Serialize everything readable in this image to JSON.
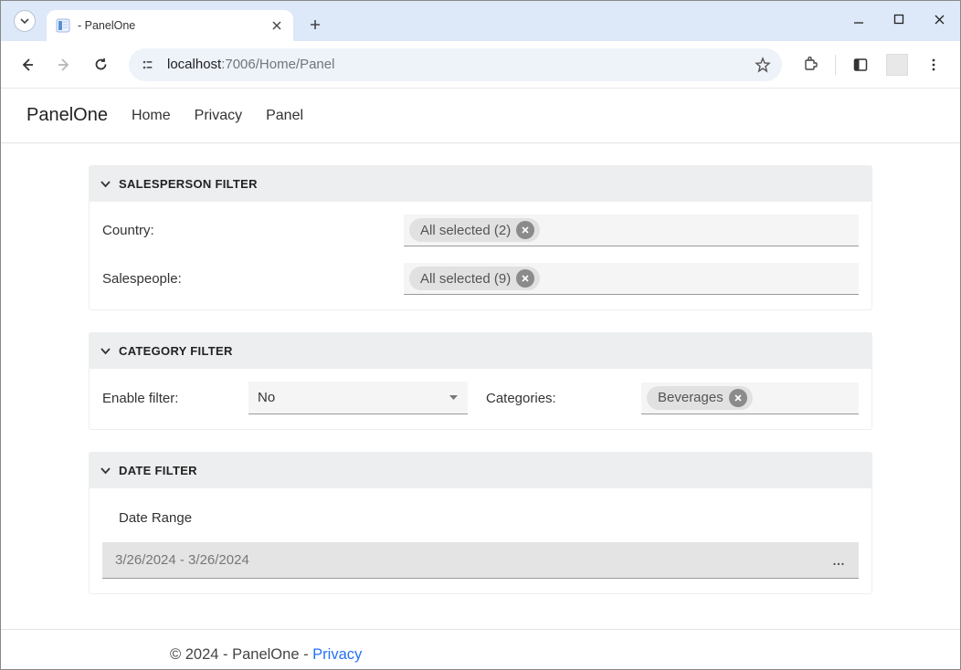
{
  "browser": {
    "tab_title": " - PanelOne",
    "url_host": "localhost",
    "url_rest": ":7006/Home/Panel"
  },
  "nav": {
    "brand": "PanelOne",
    "links": [
      "Home",
      "Privacy",
      "Panel"
    ]
  },
  "panels": {
    "salesperson": {
      "title": "SALESPERSON FILTER",
      "country_label": "Country:",
      "country_chip": "All selected (2)",
      "salespeople_label": "Salespeople:",
      "salespeople_chip": "All selected (9)"
    },
    "category": {
      "title": "CATEGORY FILTER",
      "enable_label": "Enable filter:",
      "enable_value": "No",
      "categories_label": "Categories:",
      "categories_chip": "Beverages"
    },
    "date": {
      "title": "DATE FILTER",
      "range_label": "Date Range",
      "range_value": "3/26/2024 - 3/26/2024"
    }
  },
  "footer": {
    "text": "© 2024 - PanelOne - ",
    "link": "Privacy"
  }
}
